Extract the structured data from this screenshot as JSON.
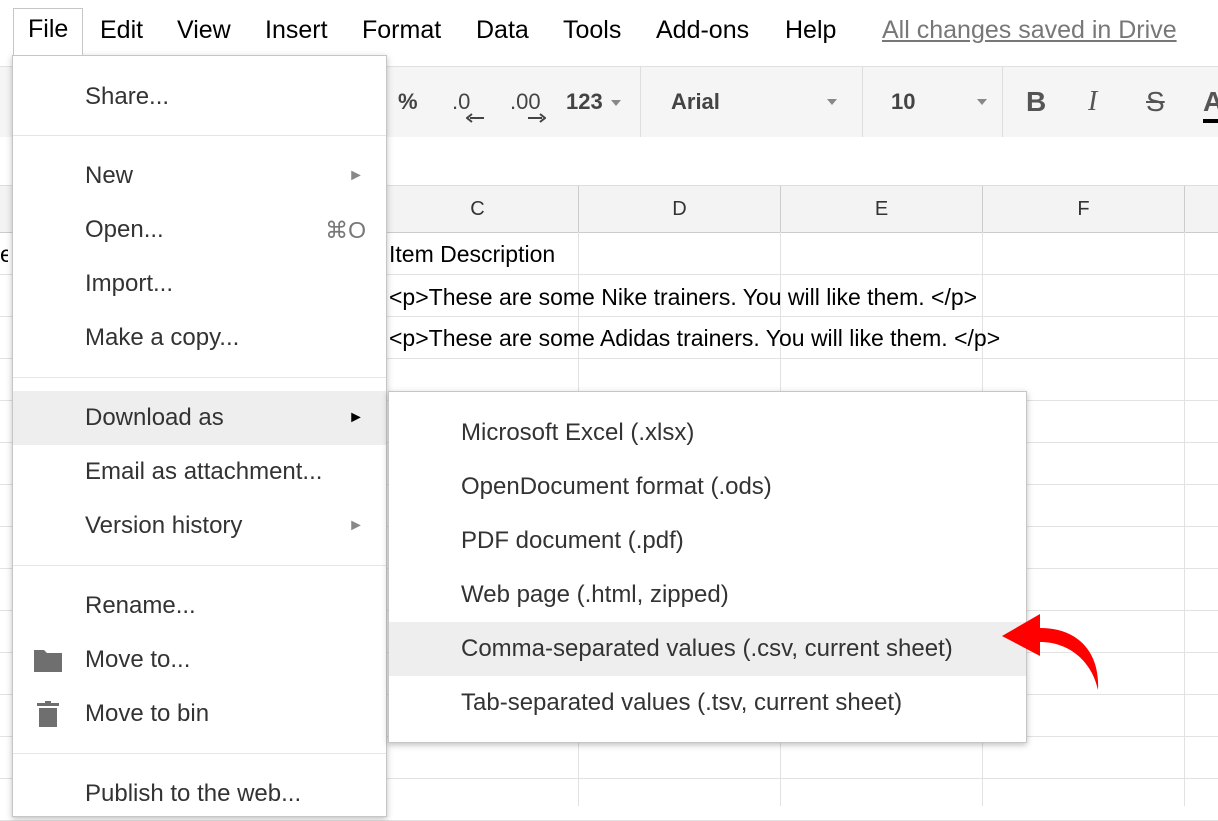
{
  "menubar": {
    "items": [
      "File",
      "Edit",
      "View",
      "Insert",
      "Format",
      "Data",
      "Tools",
      "Add-ons",
      "Help"
    ],
    "status": "All changes saved in Drive"
  },
  "toolbar": {
    "percent": "%",
    "dec_decrease": ".0",
    "dec_increase": ".00",
    "number_format": "123",
    "font": "Arial",
    "font_size": "10",
    "bold": "B",
    "italic": "I",
    "strike": "S",
    "text_color": "A"
  },
  "grid": {
    "columns": [
      "C",
      "D",
      "E",
      "F"
    ],
    "cells": [
      "Item Description",
      "<p>These are some Nike trainers. You will like them. </p>",
      "<p>These are some Adidas trainers. You will like them. </p>"
    ],
    "left_clip": "e"
  },
  "file_menu": {
    "share": "Share...",
    "new": "New",
    "open": "Open...",
    "open_shortcut": "⌘O",
    "import": "Import...",
    "make_copy": "Make a copy...",
    "download_as": "Download as",
    "email": "Email as attachment...",
    "version_history": "Version history",
    "rename": "Rename...",
    "move_to": "Move to...",
    "move_to_bin": "Move to bin",
    "publish": "Publish to the web..."
  },
  "download_submenu": {
    "items": [
      "Microsoft Excel (.xlsx)",
      "OpenDocument format (.ods)",
      "PDF document (.pdf)",
      "Web page (.html, zipped)",
      "Comma-separated values (.csv, current sheet)",
      "Tab-separated values (.tsv, current sheet)"
    ],
    "highlighted_index": 4
  },
  "colors": {
    "accent_arrow": "#ff0000",
    "highlight": "#eeeeee"
  }
}
